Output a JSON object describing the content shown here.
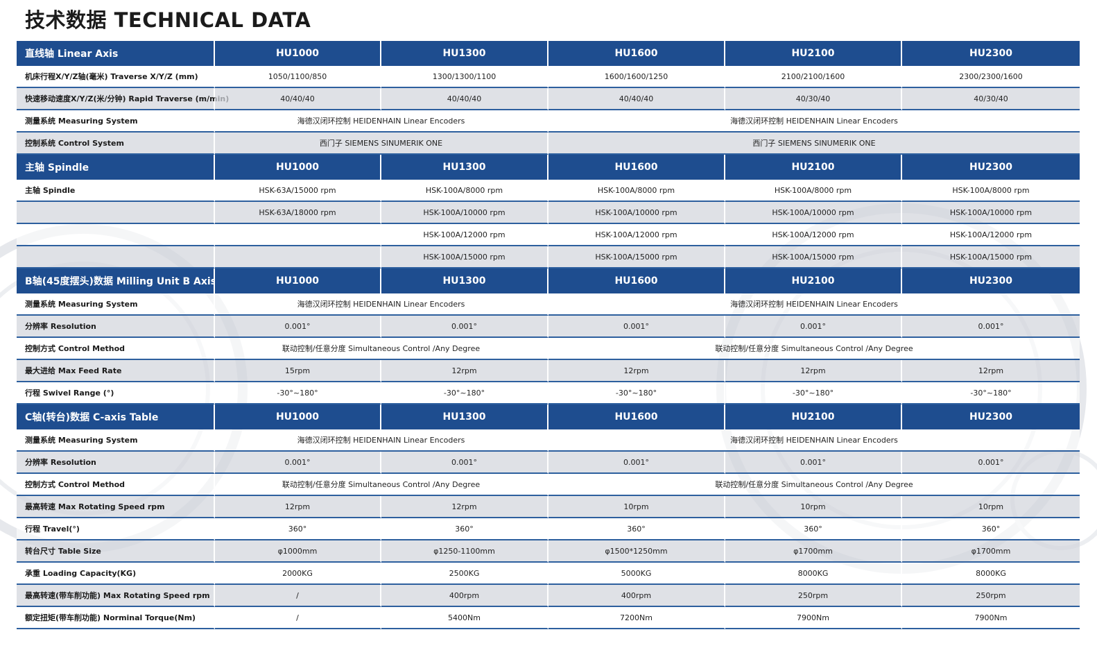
{
  "page": {
    "title": "技术数据 TECHNICAL DATA"
  },
  "models": [
    "HU1000",
    "HU1300",
    "HU1600",
    "HU2100",
    "HU2300"
  ],
  "linear": {
    "header": "直线轴 Linear Axis",
    "traverse": {
      "label": "机床行程X/Y/Z轴(毫米) Traverse X/Y/Z (mm)",
      "values": [
        "1050/1100/850",
        "1300/1300/1100",
        "1600/1600/1250",
        "2100/2100/1600",
        "2300/2300/1600"
      ]
    },
    "rapid": {
      "label": "快速移动速度X/Y/Z(米/分钟) Rapid Traverse (m/min)",
      "values": [
        "40/40/40",
        "40/40/40",
        "40/40/40",
        "40/30/40",
        "40/30/40"
      ]
    },
    "measuring": {
      "label": "测量系统 Measuring System",
      "group_a": "海德汉闭环控制 HEIDENHAIN Linear Encoders",
      "group_b": "海德汉闭环控制 HEIDENHAIN Linear Encoders"
    },
    "control": {
      "label": "控制系统 Control System",
      "group_a": "西门子 SIEMENS SINUMERIK ONE",
      "group_b": "西门子 SIEMENS SINUMERIK ONE"
    }
  },
  "spindle": {
    "header": "主轴 Spindle",
    "label": "主轴 Spindle",
    "rows": [
      [
        "HSK-63A/15000 rpm",
        "HSK-100A/8000 rpm",
        "HSK-100A/8000 rpm",
        "HSK-100A/8000 rpm",
        "HSK-100A/8000 rpm"
      ],
      [
        "HSK-63A/18000 rpm",
        "HSK-100A/10000 rpm",
        "HSK-100A/10000 rpm",
        "HSK-100A/10000 rpm",
        "HSK-100A/10000 rpm"
      ],
      [
        "",
        "HSK-100A/12000 rpm",
        "HSK-100A/12000 rpm",
        "HSK-100A/12000 rpm",
        "HSK-100A/12000 rpm"
      ],
      [
        "",
        "HSK-100A/15000 rpm",
        "HSK-100A/15000 rpm",
        "HSK-100A/15000 rpm",
        "HSK-100A/15000 rpm"
      ]
    ]
  },
  "baxis": {
    "header": "B轴(45度摆头)数据 Milling Unit B Axis",
    "measuring": {
      "label": "测量系统 Measuring System",
      "group_a": "海德汉闭环控制 HEIDENHAIN Linear Encoders",
      "group_b": "海德汉闭环控制 HEIDENHAIN Linear Encoders"
    },
    "resolution": {
      "label": "分辨率 Resolution",
      "values": [
        "0.001°",
        "0.001°",
        "0.001°",
        "0.001°",
        "0.001°"
      ]
    },
    "control": {
      "label": "控制方式 Control Method",
      "group_a": "联动控制/任意分度 Simultaneous Control /Any Degree",
      "group_b": "联动控制/任意分度 Simultaneous Control /Any Degree"
    },
    "feed": {
      "label": "最大进给 Max Feed Rate",
      "values": [
        "15rpm",
        "12rpm",
        "12rpm",
        "12rpm",
        "12rpm"
      ]
    },
    "swivel": {
      "label": "行程 Swivel Range (°)",
      "values": [
        "-30°~180°",
        "-30°~180°",
        "-30°~180°",
        "-30°~180°",
        "-30°~180°"
      ]
    }
  },
  "caxis": {
    "header": "C轴(转台)数据 C-axis Table",
    "measuring": {
      "label": "测量系统 Measuring System",
      "group_a": "海德汉闭环控制 HEIDENHAIN Linear Encoders",
      "group_b": "海德汉闭环控制 HEIDENHAIN Linear Encoders"
    },
    "resolution": {
      "label": "分辨率 Resolution",
      "values": [
        "0.001°",
        "0.001°",
        "0.001°",
        "0.001°",
        "0.001°"
      ]
    },
    "control": {
      "label": "控制方式 Control Method",
      "group_a": "联动控制/任意分度 Simultaneous Control /Any Degree",
      "group_b": "联动控制/任意分度 Simultaneous Control /Any Degree"
    },
    "max_speed": {
      "label": "最高转速 Max Rotating Speed rpm",
      "values": [
        "12rpm",
        "12rpm",
        "10rpm",
        "10rpm",
        "10rpm"
      ]
    },
    "travel": {
      "label": "行程 Travel(°)",
      "values": [
        "360°",
        "360°",
        "360°",
        "360°",
        "360°"
      ]
    },
    "table_size": {
      "label": "转台尺寸 Table Size",
      "values": [
        "φ1000mm",
        "φ1250-1100mm",
        "φ1500*1250mm",
        "φ1700mm",
        "φ1700mm"
      ]
    },
    "loading": {
      "label": "承重 Loading Capacity(KG)",
      "values": [
        "2000KG",
        "2500KG",
        "5000KG",
        "8000KG",
        "8000KG"
      ]
    },
    "turning_speed": {
      "label": "最高转速(带车削功能) Max Rotating Speed rpm",
      "values": [
        "/",
        "400rpm",
        "400rpm",
        "250rpm",
        "250rpm"
      ]
    },
    "torque": {
      "label": "额定扭矩(带车削功能) Norminal Torque(Nm)",
      "values": [
        "/",
        "5400Nm",
        "7200Nm",
        "7900Nm",
        "7900Nm"
      ]
    }
  }
}
